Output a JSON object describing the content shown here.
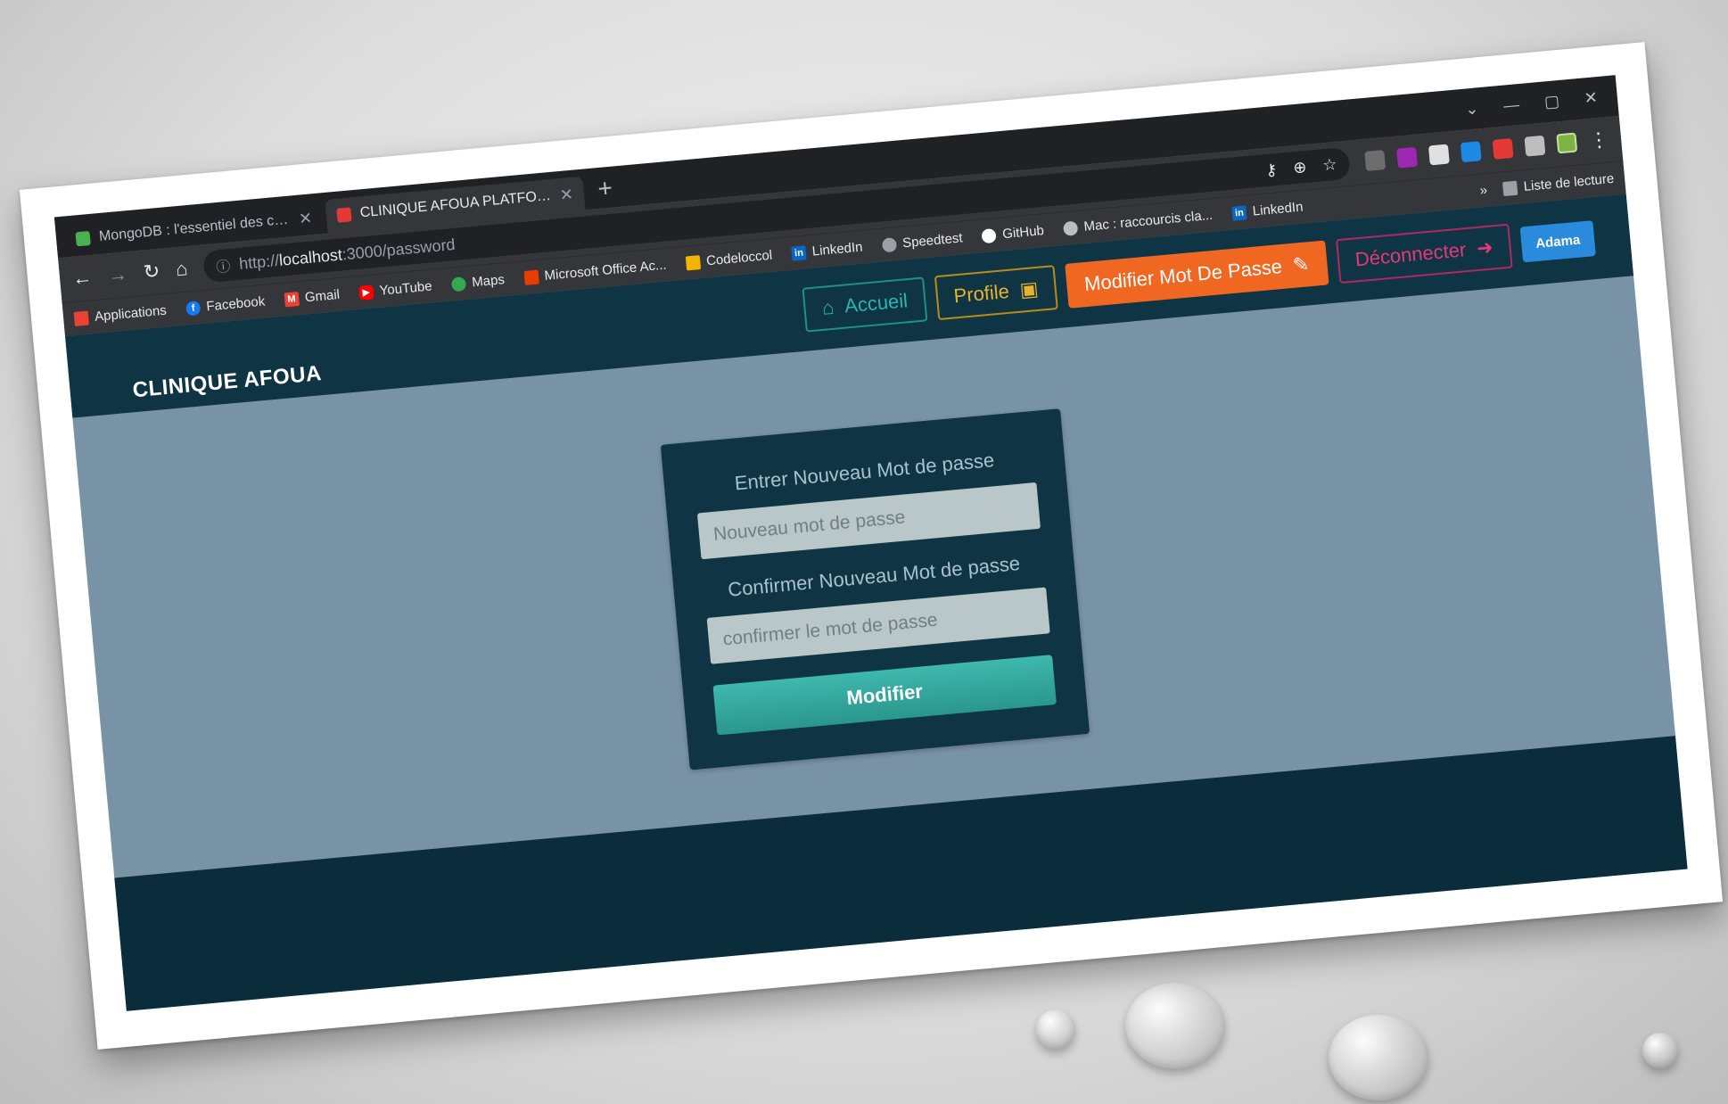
{
  "browser": {
    "tabs": [
      {
        "title": "MongoDB : l'essentiel des comm",
        "active": false
      },
      {
        "title": "CLINIQUE AFOUA PLATFORM",
        "active": true
      }
    ],
    "url_scheme": "http://",
    "url_host": "localhost",
    "url_path": ":3000/password",
    "bookmarks": [
      {
        "label": "Applications",
        "icon": "apps-grid-icon",
        "color": "#ea4335"
      },
      {
        "label": "Facebook",
        "icon": "facebook-icon",
        "color": "#1877f2"
      },
      {
        "label": "Gmail",
        "icon": "gmail-icon",
        "color": "#ea4335"
      },
      {
        "label": "YouTube",
        "icon": "youtube-icon",
        "color": "#ff0000"
      },
      {
        "label": "Maps",
        "icon": "maps-icon",
        "color": "#34a853"
      },
      {
        "label": "Microsoft Office Ac...",
        "icon": "office-icon",
        "color": "#eb3c00"
      },
      {
        "label": "Codeloccol",
        "icon": "codeloccol-icon",
        "color": "#f4b400"
      },
      {
        "label": "LinkedIn",
        "icon": "linkedin-icon",
        "color": "#0a66c2"
      },
      {
        "label": "Speedtest",
        "icon": "speedtest-icon",
        "color": "#9aa0a6"
      },
      {
        "label": "GitHub",
        "icon": "github-icon",
        "color": "#ffffff"
      },
      {
        "label": "Mac : raccourcis cla...",
        "icon": "apple-icon",
        "color": "#bdbdbd"
      },
      {
        "label": "LinkedIn",
        "icon": "linkedin-icon",
        "color": "#0a66c2"
      }
    ],
    "bookmarks_overflow": "»",
    "reading_list": "Liste de lecture"
  },
  "app": {
    "brand": "CLINIQUE AFOUA",
    "nav": {
      "accueil": "Accueil",
      "profile": "Profile",
      "change_password": "Modifier Mot De Passe",
      "logout": "Déconnecter",
      "user": "Adama"
    },
    "form": {
      "new_label": "Entrer Nouveau Mot de passe",
      "new_placeholder": "Nouveau mot de passe",
      "confirm_label": "Confirmer Nouveau Mot de passe",
      "confirm_placeholder": "confirmer le mot de passe",
      "submit": "Modifier"
    }
  },
  "colors": {
    "navbar": "#0f3544",
    "page_bg": "#7993a6",
    "accent_orange": "#f06722",
    "accent_teal": "#3fb8ad",
    "accent_yellow": "#e8b32b",
    "accent_pink": "#e4387a",
    "accent_blue": "#2a8bdc"
  }
}
